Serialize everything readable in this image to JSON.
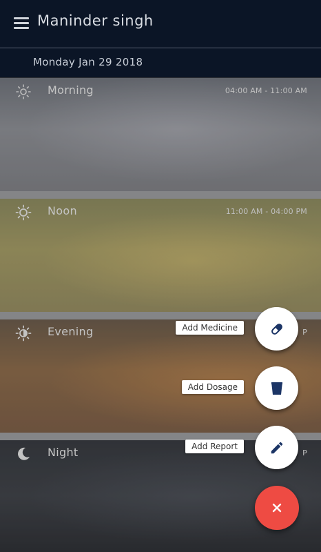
{
  "header": {
    "title": "Maninder singh",
    "menu_icon": "menu-icon"
  },
  "date": "Monday Jan 29 2018",
  "slots": [
    {
      "label": "Morning",
      "time": "04:00 AM - 11:00 AM",
      "icon": "sun-outline-icon"
    },
    {
      "label": "Noon",
      "time": "11:00 AM - 04:00 PM",
      "icon": "sun-icon"
    },
    {
      "label": "Evening",
      "time": "P",
      "icon": "half-sun-icon"
    },
    {
      "label": "Night",
      "time": "P",
      "icon": "moon-icon"
    }
  ],
  "fab_menu": {
    "items": [
      {
        "label": "Add Medicine",
        "icon": "pill-icon"
      },
      {
        "label": "Add Dosage",
        "icon": "cup-icon"
      },
      {
        "label": "Add Report",
        "icon": "pencil-icon"
      }
    ],
    "close_icon": "close-icon",
    "colors": {
      "accent": "#ee4b43",
      "icon": "#1c3566"
    }
  }
}
